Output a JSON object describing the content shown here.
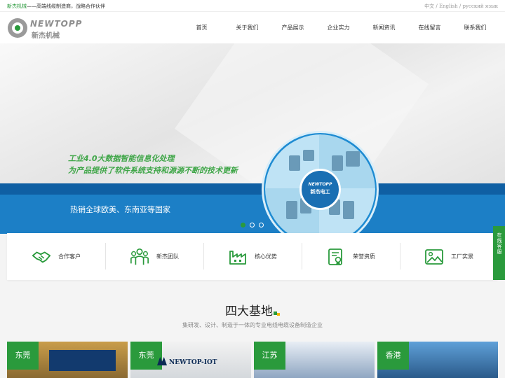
{
  "topbar": {
    "brand": "新杰机械",
    "slogan": "——高端线缆制造商，战略合作伙伴",
    "languages": [
      "中文",
      "English",
      "русский язык"
    ],
    "separator": " / "
  },
  "logo": {
    "en": "NEWTOPP",
    "cn": "新杰机械"
  },
  "nav": [
    "首页",
    "关于我们",
    "产品展示",
    "企业实力",
    "新闻资讯",
    "在线留言",
    "联系我们"
  ],
  "banner": {
    "headline_line1": "工业4.0大数据智能信息化处理",
    "headline_line2": "为产品提供了软件系统支持和源源不断的技术更新",
    "subline": "热销全球欧美、东南亚等国家",
    "center_logo_en": "NEWTOPP",
    "center_logo_cn": "新杰电工",
    "slides_total": 3,
    "active_slide": 1
  },
  "features": [
    {
      "icon": "handshake-icon",
      "label": "合作客户"
    },
    {
      "icon": "team-icon",
      "label": "新杰团队"
    },
    {
      "icon": "factory-icon",
      "label": "核心优势"
    },
    {
      "icon": "certificate-icon",
      "label": "荣誉资质"
    },
    {
      "icon": "image-icon",
      "label": "工厂实景"
    }
  ],
  "side_button": "在线客服",
  "section": {
    "title": "四大基地",
    "subtitle": "集研发、设计、制造于一体的专业电线电缆设备制造企业"
  },
  "bases": [
    {
      "tag": "东莞"
    },
    {
      "tag": "东莞",
      "sign": "NEWTOP-IOT"
    },
    {
      "tag": "江苏"
    },
    {
      "tag": "香港"
    }
  ],
  "colors": {
    "brand_green": "#2a9a3c",
    "banner_blue": "#1c7fc6",
    "accent_yellow": "#f2b500"
  }
}
